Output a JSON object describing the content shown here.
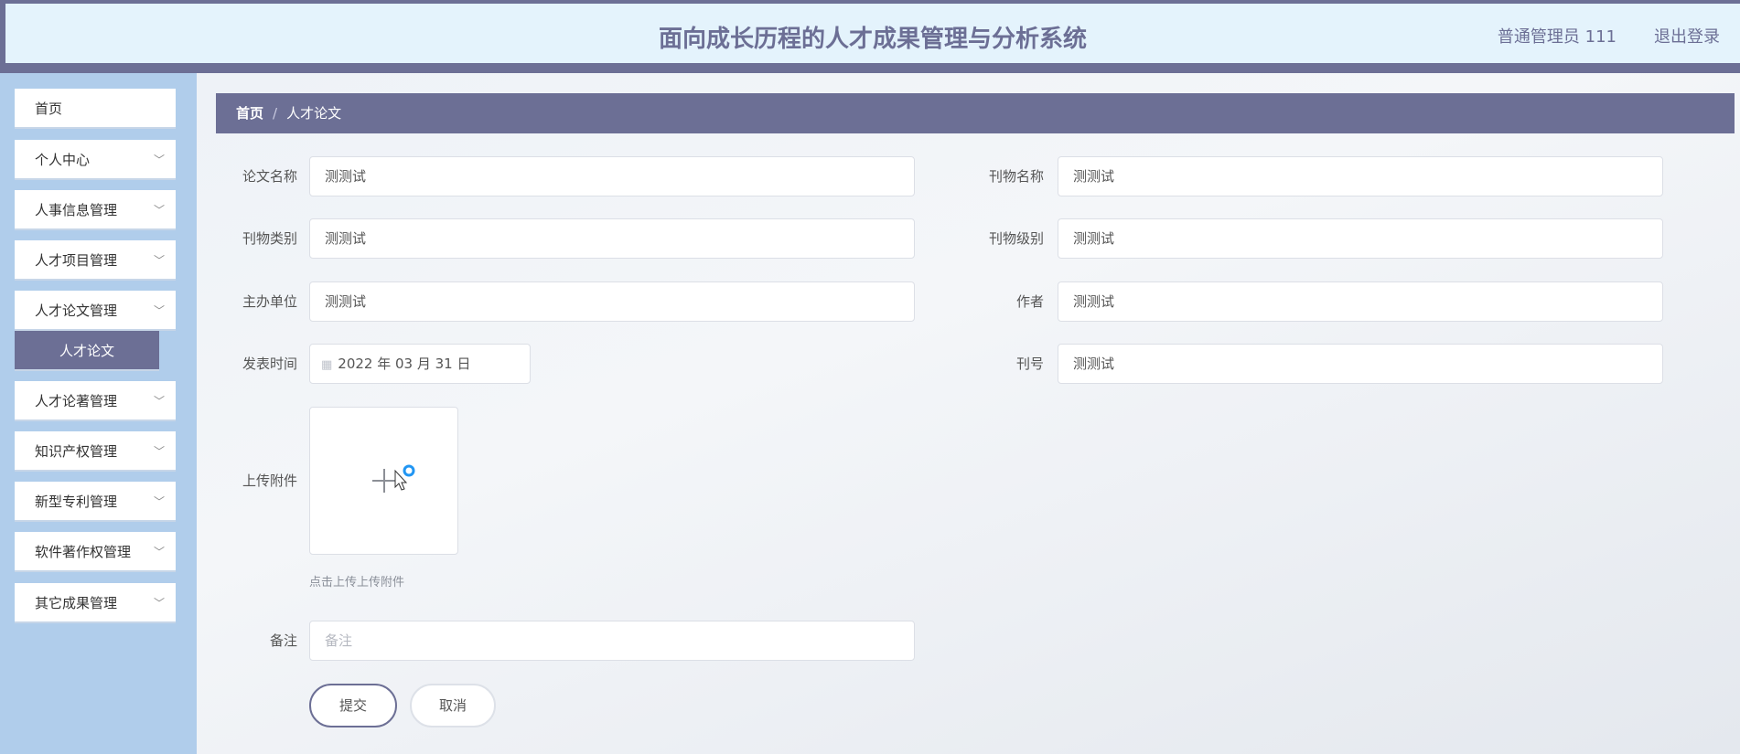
{
  "header": {
    "title": "面向成长历程的人才成果管理与分析系统",
    "user": "普通管理员 111",
    "logout": "退出登录"
  },
  "sidebar": {
    "items": [
      {
        "label": "首页"
      },
      {
        "label": "个人中心"
      },
      {
        "label": "人事信息管理"
      },
      {
        "label": "人才项目管理"
      },
      {
        "label": "人才论文管理"
      },
      {
        "label": "人才论文"
      },
      {
        "label": "人才论著管理"
      },
      {
        "label": "知识产权管理"
      },
      {
        "label": "新型专利管理"
      },
      {
        "label": "软件著作权管理"
      },
      {
        "label": "其它成果管理"
      }
    ]
  },
  "breadcrumb": {
    "home": "首页",
    "sep": "/",
    "current": "人才论文"
  },
  "form": {
    "paper_name": {
      "label": "论文名称",
      "value": "测测试"
    },
    "journal_name": {
      "label": "刊物名称",
      "value": "测测试"
    },
    "journal_type": {
      "label": "刊物类别",
      "value": "测测试"
    },
    "journal_level": {
      "label": "刊物级别",
      "value": "测测试"
    },
    "organizer": {
      "label": "主办单位",
      "value": "测测试"
    },
    "author": {
      "label": "作者",
      "value": "测测试"
    },
    "publish_date": {
      "label": "发表时间",
      "value": "2022 年 03 月 31 日"
    },
    "issue": {
      "label": "刊号",
      "value": "测测试"
    },
    "attachment": {
      "label": "上传附件",
      "hint": "点击上传上传附件"
    },
    "remark": {
      "label": "备注",
      "placeholder": "备注"
    },
    "submit": "提交",
    "cancel": "取消"
  },
  "colors": {
    "accent": "#6c6f95",
    "header_bg": "#e4f3fc",
    "sidebar_bg": "#b0cdeb",
    "cursor_ring": "#2196f3"
  }
}
